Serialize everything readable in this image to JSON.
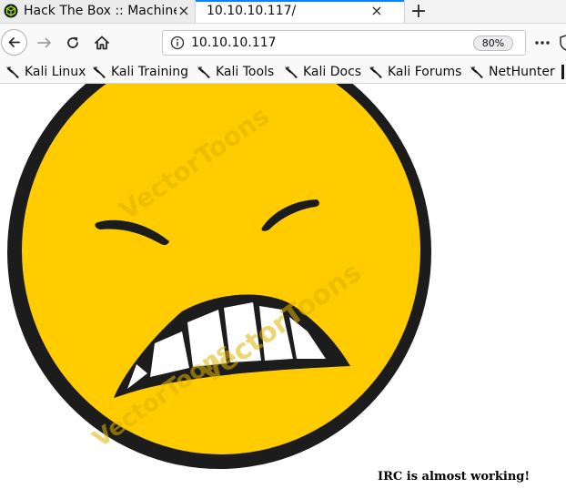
{
  "tabs": [
    {
      "title": "Hack The Box :: Machines",
      "favicon": "hackthebox-cube-icon"
    },
    {
      "title": "10.10.10.117/"
    }
  ],
  "new_tab_symbol": "+",
  "close_symbol": "×",
  "navigation": {
    "url": "10.10.10.117",
    "zoom": "80%",
    "icons": [
      "back-arrow-icon",
      "forward-arrow-icon",
      "reload-icon",
      "home-icon",
      "info-icon",
      "more-dots-icon",
      "shield-icon"
    ]
  },
  "bookmarks": [
    {
      "label": "Kali Linux",
      "icon": "kali-dragon-icon"
    },
    {
      "label": "Kali Training",
      "icon": "kali-dragon-icon"
    },
    {
      "label": "Kali Tools",
      "icon": "kali-dragon-icon"
    },
    {
      "label": "Kali Docs",
      "icon": "kali-dragon-icon"
    },
    {
      "label": "Kali Forums",
      "icon": "kali-dragon-icon"
    },
    {
      "label": "NetHunter",
      "icon": "kali-dragon-icon"
    }
  ],
  "page": {
    "image": "angry-grimace-emoji",
    "message": "IRC is almost working!"
  },
  "colors": {
    "tab_accent": "#0a84ff",
    "emoji_fill": "#ffcc00",
    "emoji_outline": "#1a1a1a",
    "toolbar_bg": "#f9f9fa"
  }
}
